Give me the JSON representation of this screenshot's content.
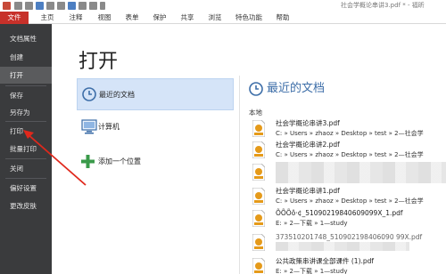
{
  "window": {
    "title": "社会学概论串讲3.pdf * - 福昕"
  },
  "ribbon": {
    "file": "文件",
    "tabs": [
      "主页",
      "注释",
      "视图",
      "表单",
      "保护",
      "共享",
      "浏览",
      "特色功能",
      "帮助"
    ]
  },
  "left_menu": {
    "items": [
      "文档属性",
      "创建",
      "打开",
      "保存",
      "另存为",
      "打印",
      "批量打印",
      "关闭",
      "偏好设置",
      "更改皮肤"
    ],
    "active_index": 2
  },
  "main": {
    "title": "打开",
    "options": [
      "最近的文档",
      "计算机",
      "添加一个位置"
    ]
  },
  "recent": {
    "title": "最近的文档",
    "section": "本地",
    "files": [
      {
        "name": "社会学概论串讲3.pdf",
        "path": "C: » Users » zhaoz » Desktop » test » 2—社会学"
      },
      {
        "name": "社会学概论串讲2.pdf",
        "path": "C: » Users » zhaoz » Desktop » test » 2—社会学"
      },
      {
        "name": "",
        "path": ""
      },
      {
        "name": "社会学概论串讲1.pdf",
        "path": "C: » Users » zhaoz » Desktop » test » 2—社会学"
      },
      {
        "name": "ÕÕÕô·¢_51090219840609099X_1.pdf",
        "path": "E: » 2—下载 » 1—study"
      },
      {
        "name": "373510201748_510902198406090 99X.pdf",
        "path": ""
      },
      {
        "name": "公共政策串讲课全部课件 (1).pdf",
        "path": "E: » 2—下载 » 1—study"
      }
    ]
  },
  "colors": {
    "accent": "#c7312a",
    "menu_bg": "#3a3b3d",
    "selected": "#d5e4f8",
    "link": "#3d6ea8",
    "arrow": "#e0281c"
  }
}
